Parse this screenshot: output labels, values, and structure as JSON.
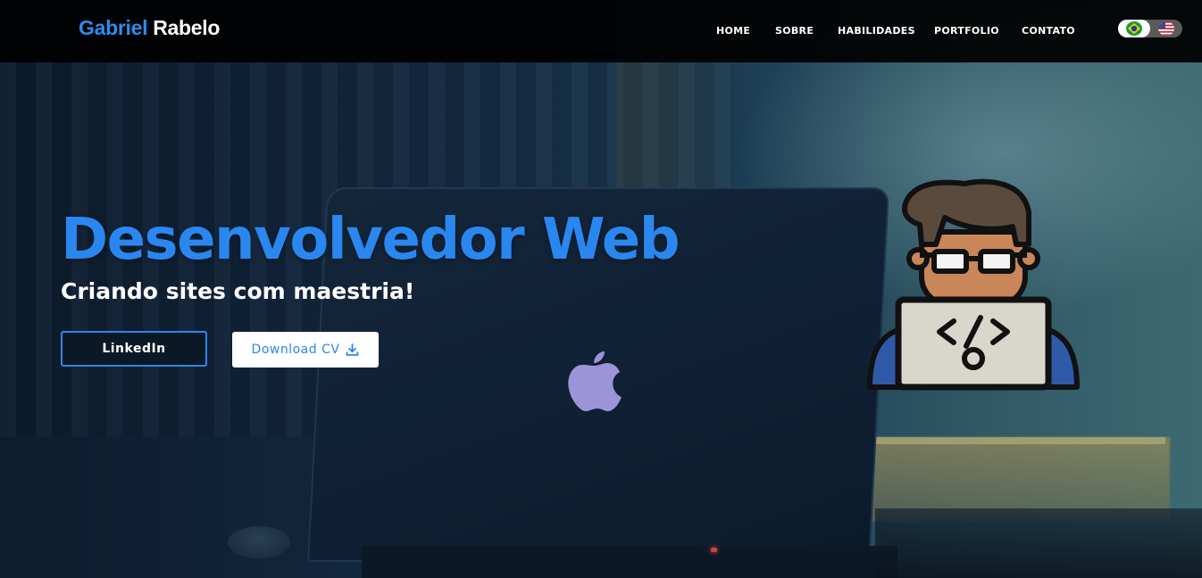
{
  "brand": {
    "first": "Gabriel",
    "last": "Rabelo"
  },
  "nav": {
    "items": [
      {
        "label": "HOME"
      },
      {
        "label": "SOBRE"
      },
      {
        "label": "HABILIDADES"
      },
      {
        "label": "PORTFOLIO"
      },
      {
        "label": "CONTATO"
      }
    ]
  },
  "language_toggle": {
    "options": [
      "brazil-flag-icon",
      "usa-flag-icon"
    ],
    "selected": "brazil-flag-icon"
  },
  "hero": {
    "title": "Desenvolvedor Web",
    "subtitle": "Criando sites com maestria!",
    "buttons": {
      "linkedin": "LinkedIn",
      "download_cv": "Download CV"
    },
    "icons": {
      "download": "download-icon",
      "avatar": "developer-avatar-icon",
      "apple": "apple-logo-icon"
    }
  },
  "colors": {
    "accent": "#2b87f0",
    "navbar_bg": "#000000",
    "text_light": "#ffffff"
  }
}
